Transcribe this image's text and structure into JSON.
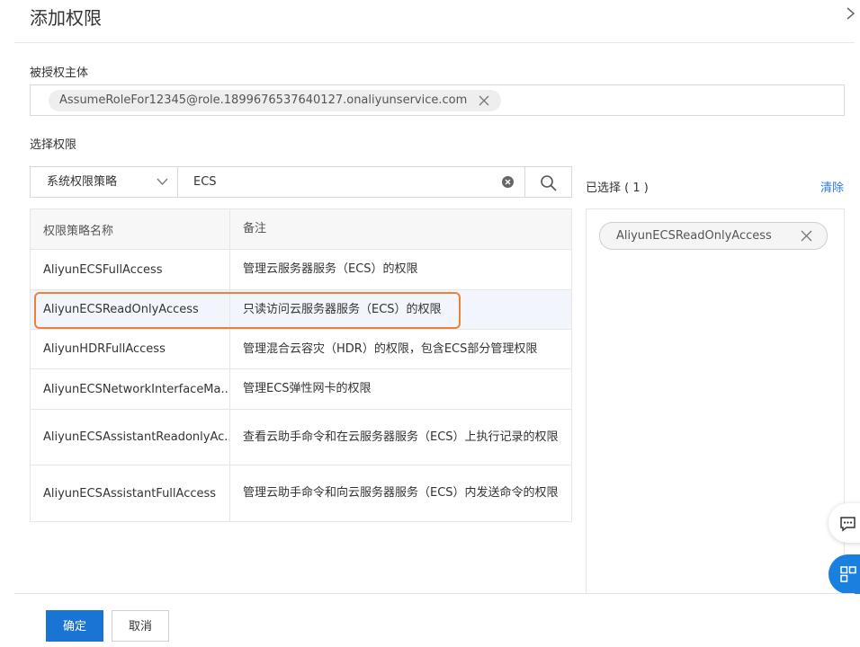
{
  "dialog": {
    "title": "添加权限"
  },
  "principal": {
    "label": "被授权主体",
    "tag": "AssumeRoleFor12345@role.1899676537640127.onaliyunservice.com"
  },
  "permission": {
    "label": "选择权限",
    "policy_type": "系统权限策略",
    "search_value": "ECS",
    "columns": [
      "权限策略名称",
      "备注"
    ],
    "rows": [
      {
        "name": "AliyunECSFullAccess",
        "note": "管理云服务器服务（ECS）的权限"
      },
      {
        "name": "AliyunECSReadOnlyAccess",
        "note": "只读访问云服务器服务（ECS）的权限"
      },
      {
        "name": "AliyunHDRFullAccess",
        "note": "管理混合云容灾（HDR）的权限，包含ECS部分管理权限"
      },
      {
        "name": "AliyunECSNetworkInterfaceMa...",
        "note": "管理ECS弹性网卡的权限"
      },
      {
        "name": "AliyunECSAssistantReadonlyAc...",
        "note": "查看云助手命令和在云服务器服务（ECS）上执行记录的权限"
      },
      {
        "name": "AliyunECSAssistantFullAccess",
        "note": "管理云助手命令和向云服务器服务（ECS）内发送命令的权限"
      }
    ]
  },
  "selected": {
    "label": "已选择 ( 1 )",
    "clear": "清除",
    "items": [
      "AliyunECSReadOnlyAccess"
    ]
  },
  "footer": {
    "ok": "确定",
    "cancel": "取消"
  },
  "colors": {
    "primary": "#1a74d4",
    "link": "#2a7ad6",
    "highlight": "#e8833a",
    "selected_row": "#f2f6fc"
  },
  "icons": [
    "close-icon",
    "chevron-down-icon",
    "clear-circle-icon",
    "search-icon",
    "chat-icon",
    "apps-icon"
  ]
}
